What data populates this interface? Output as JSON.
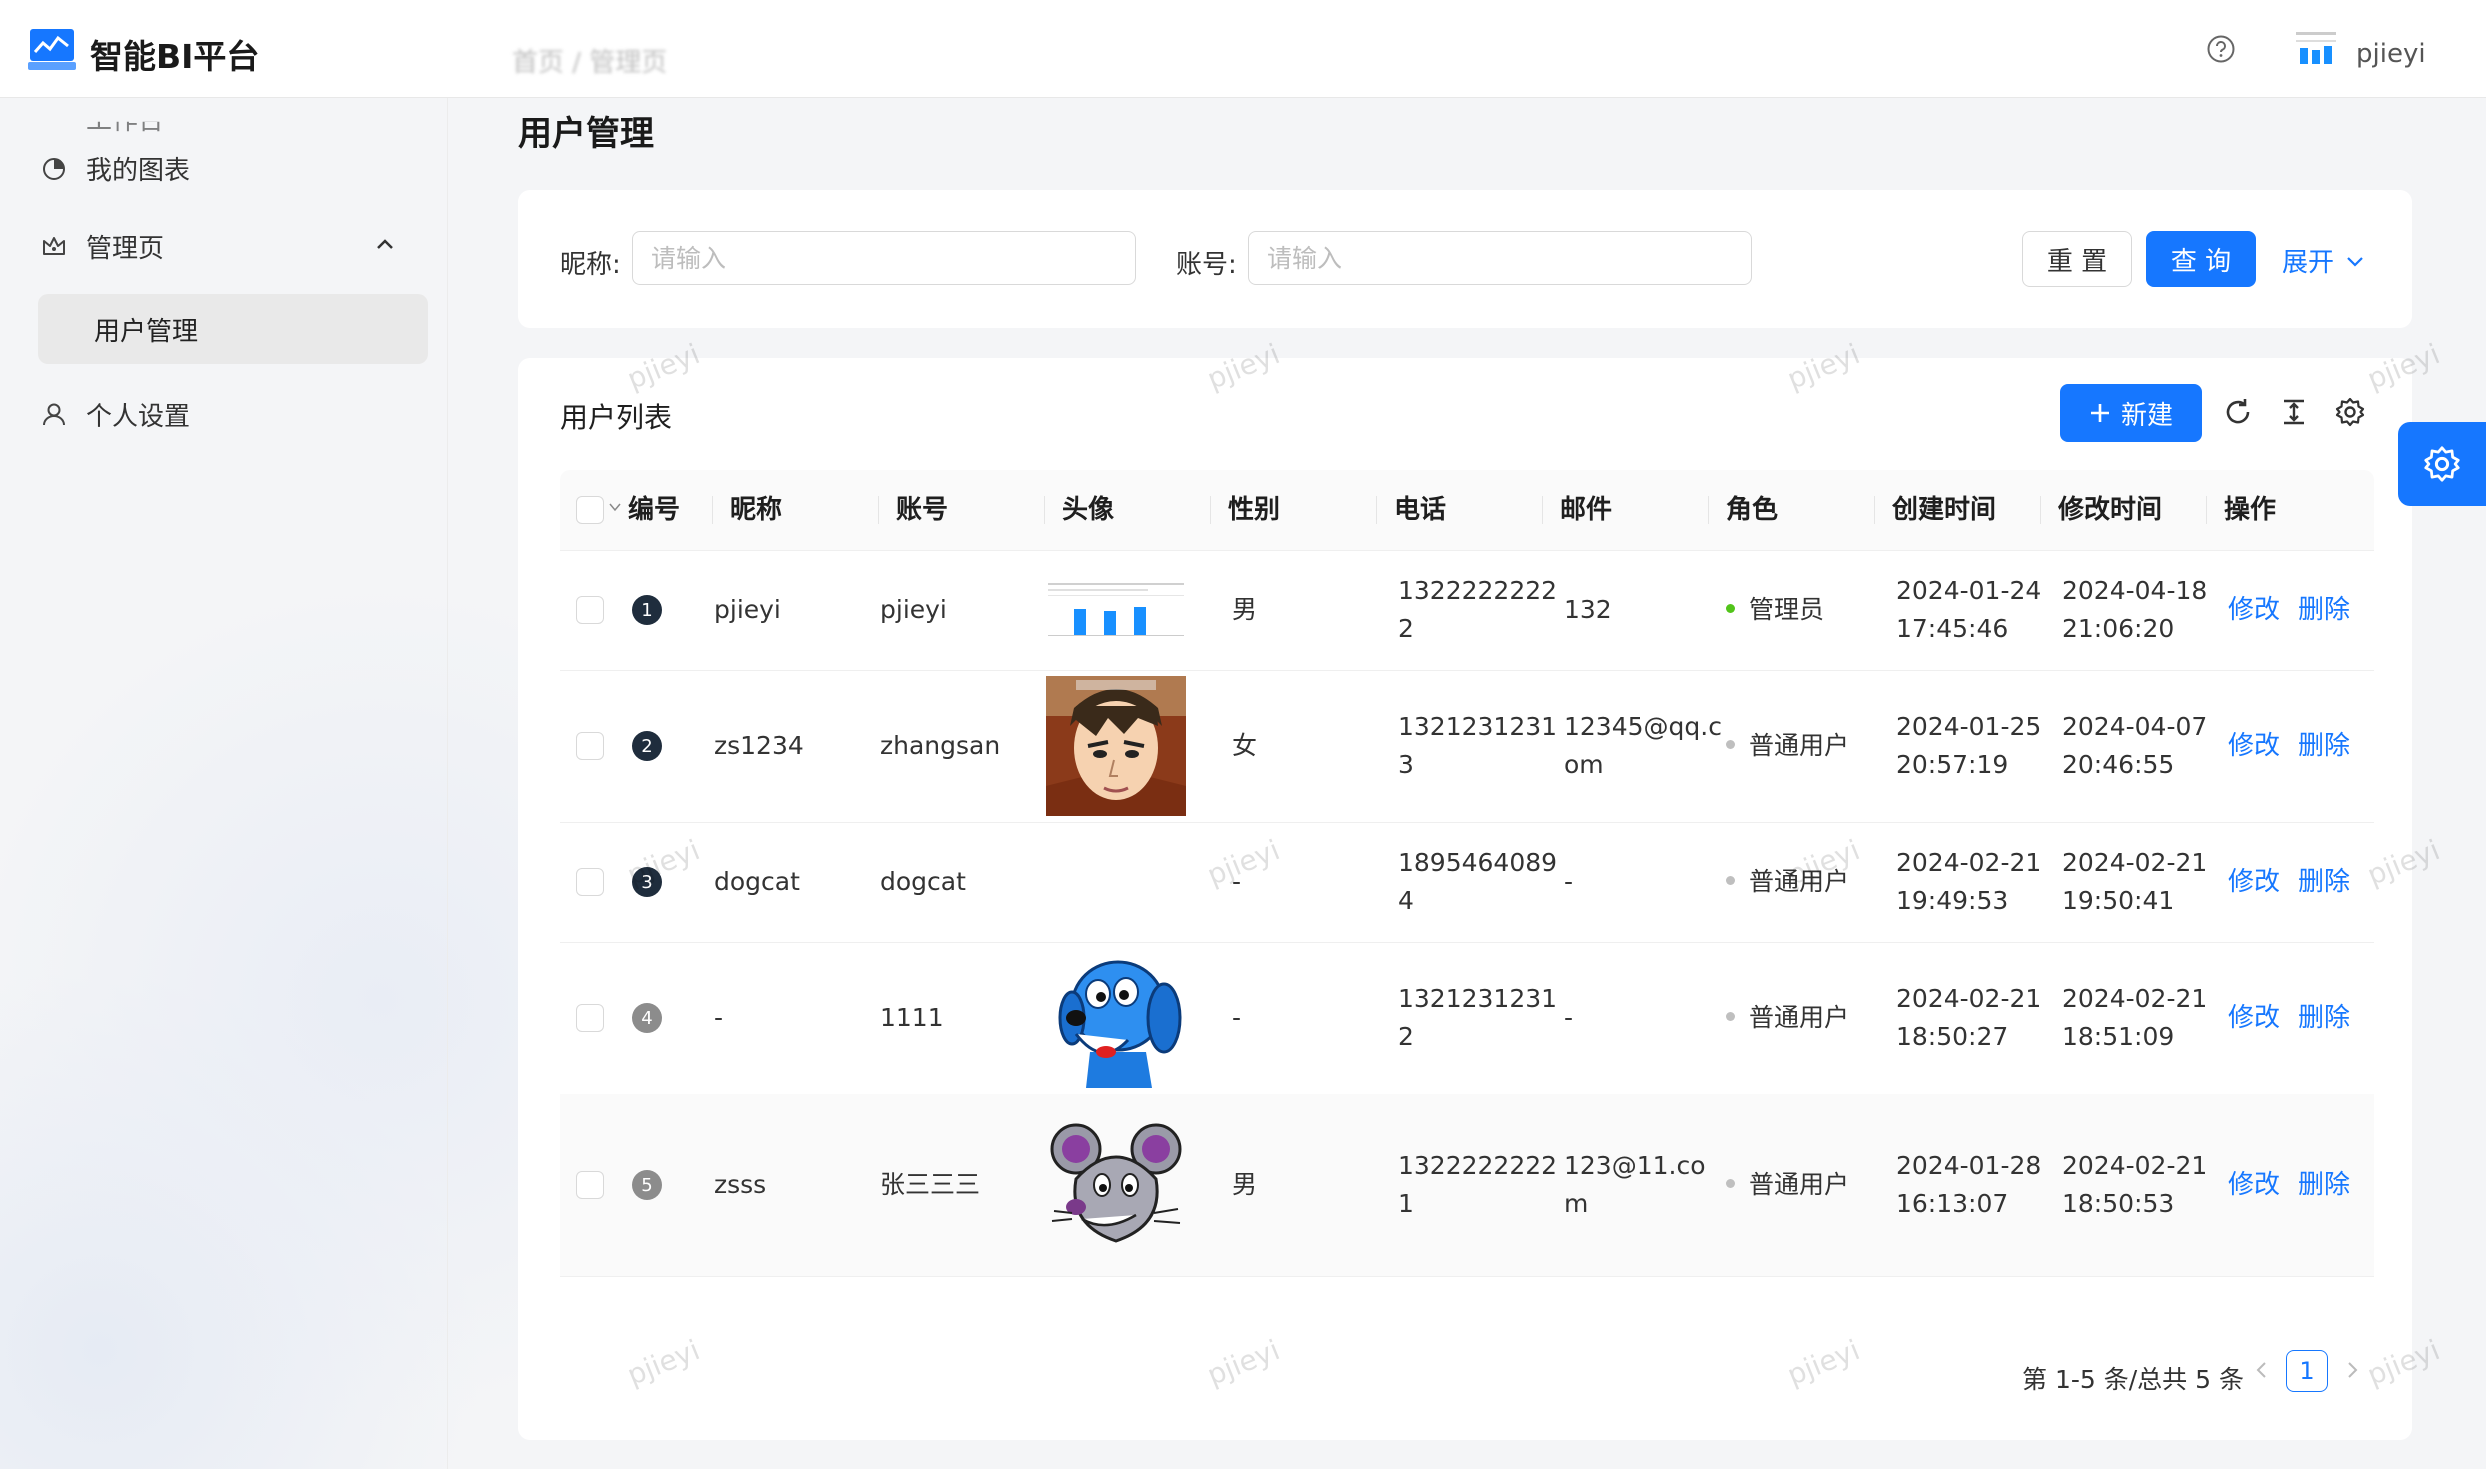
{
  "app": {
    "title": "智能BI平台",
    "breadcrumb": "首页 / 管理页",
    "user_name": "pjieyi"
  },
  "sidebar": {
    "top_partial": "工作台",
    "items": [
      {
        "label": "我的图表",
        "icon": "pie-chart-icon"
      },
      {
        "label": "管理页",
        "icon": "crown-icon"
      },
      {
        "label": "用户管理"
      },
      {
        "label": "个人设置",
        "icon": "user-icon"
      }
    ]
  },
  "page": {
    "title": "用户管理"
  },
  "search": {
    "nickname_label": "昵称:",
    "nickname_placeholder": "请输入",
    "account_label": "账号:",
    "account_placeholder": "请输入",
    "reset_label": "重 置",
    "query_label": "查 询",
    "expand_label": "展开"
  },
  "table": {
    "title": "用户列表",
    "new_label": "新建",
    "columns": [
      "编号",
      "昵称",
      "账号",
      "头像",
      "性别",
      "电话",
      "邮件",
      "角色",
      "创建时间",
      "修改时间",
      "操作"
    ],
    "rows": [
      {
        "id": "1",
        "nickname": "pjieyi",
        "account": "pjieyi",
        "avatar": "chart-thumbnail",
        "gender": "男",
        "phone1": "1322222222",
        "phone2": "2",
        "email1": "132",
        "email2": "",
        "role": "管理员",
        "role_color": "#52c41a",
        "created1": "2024-01-24",
        "created2": "17:45:46",
        "updated1": "2024-04-18",
        "updated2": "21:06:20",
        "edit": "修改",
        "delete": "删除"
      },
      {
        "id": "2",
        "nickname": "zs1234",
        "account": "zhangsan",
        "avatar": "anime-man",
        "gender": "女",
        "phone1": "1321231231",
        "phone2": "3",
        "email1": "12345@qq.c",
        "email2": "om",
        "role": "普通用户",
        "role_color": "#bfbfbf",
        "created1": "2024-01-25",
        "created2": "20:57:19",
        "updated1": "2024-04-07",
        "updated2": "20:46:55",
        "edit": "修改",
        "delete": "删除"
      },
      {
        "id": "3",
        "nickname": "dogcat",
        "account": "dogcat",
        "avatar": "none",
        "gender": "-",
        "phone1": "1895464089",
        "phone2": "4",
        "email1": "-",
        "email2": "",
        "role": "普通用户",
        "role_color": "#bfbfbf",
        "created1": "2024-02-21",
        "created2": "19:49:53",
        "updated1": "2024-02-21",
        "updated2": "19:50:41",
        "edit": "修改",
        "delete": "删除"
      },
      {
        "id": "4",
        "nickname": "-",
        "account": "1111",
        "avatar": "blue-dog",
        "gender": "-",
        "phone1": "1321231231",
        "phone2": "2",
        "email1": "-",
        "email2": "",
        "role": "普通用户",
        "role_color": "#bfbfbf",
        "created1": "2024-02-21",
        "created2": "18:50:27",
        "updated1": "2024-02-21",
        "updated2": "18:51:09",
        "edit": "修改",
        "delete": "删除"
      },
      {
        "id": "5",
        "nickname": "zsss",
        "account": "张三三三",
        "avatar": "cartoon-mouse",
        "gender": "男",
        "phone1": "1322222222",
        "phone2": "1",
        "email1": "123@11.co",
        "email2": "m",
        "role": "普通用户",
        "role_color": "#bfbfbf",
        "created1": "2024-01-28",
        "created2": "16:13:07",
        "updated1": "2024-02-21",
        "updated2": "18:50:53",
        "edit": "修改",
        "delete": "删除"
      }
    ],
    "pagination": {
      "summary": "第 1-5 条/总共 5 条",
      "current_page": "1"
    }
  },
  "watermark": "pjieyi",
  "colors": {
    "primary": "#1677ff",
    "admin_dot": "#52c41a",
    "user_dot": "#bfbfbf"
  }
}
